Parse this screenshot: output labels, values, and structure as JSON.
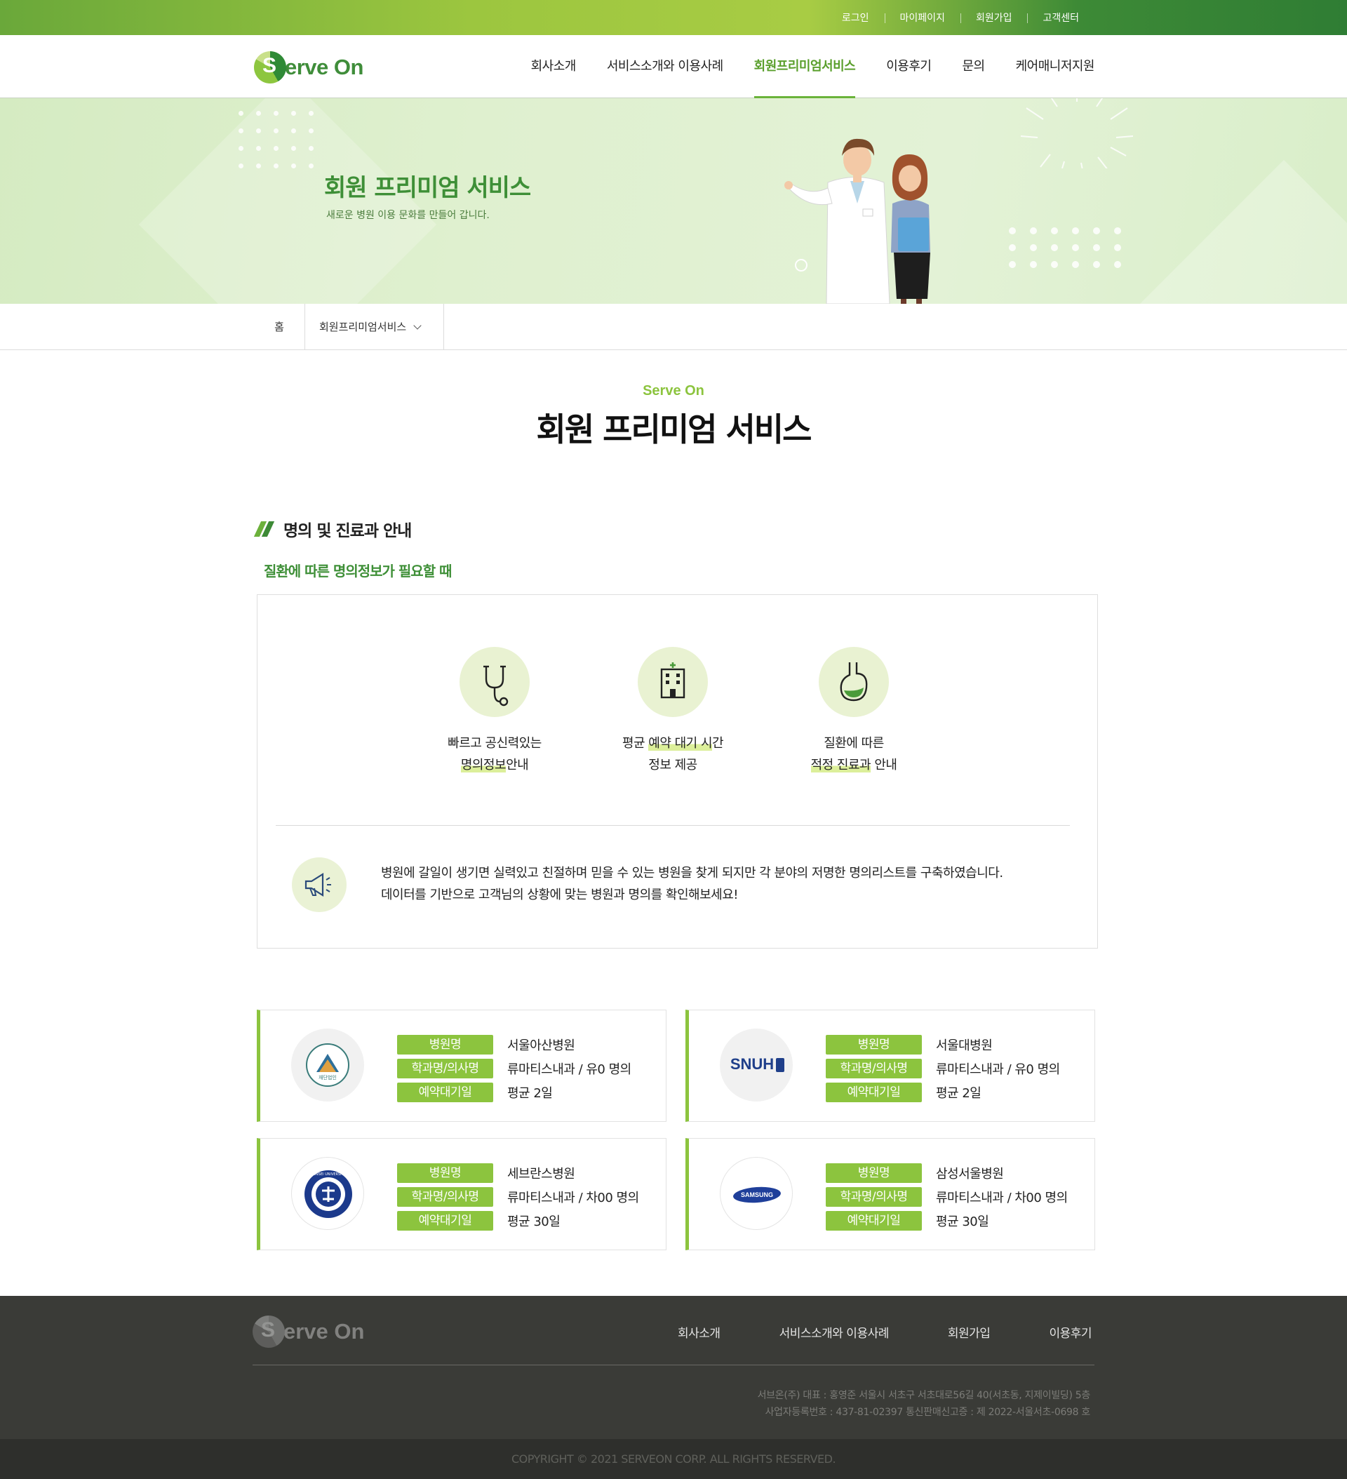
{
  "topbar": {
    "links": [
      "로그인",
      "마이페이지",
      "회원가입",
      "고객센터"
    ]
  },
  "header": {
    "logo_letter": "S",
    "logo_text": "erve On",
    "nav": [
      "회사소개",
      "서비스소개와 이용사례",
      "회원프리미엄서비스",
      "이용후기",
      "문의",
      "케어매니저지원"
    ],
    "active_nav": "회원프리미엄서비스"
  },
  "hero": {
    "title": "회원 프리미엄 서비스",
    "subtitle": "새로운 병원 이용 문화를 만들어 갑니다."
  },
  "breadcrumb": {
    "home": "홈",
    "current": "회원프리미엄서비스"
  },
  "main": {
    "brand": "Serve On",
    "title": "회원 프리미엄 서비스",
    "section_title": "명의 및 진료과 안내",
    "section_subtitle": "질환에 따른 명의정보가 필요할 때",
    "features": [
      {
        "icon": "stethoscope-icon",
        "line1": "빠르고 공신력있는",
        "line2_hl": "명의정보",
        "line2_rest": "안내"
      },
      {
        "icon": "hospital-icon",
        "line1_pre": "평균 ",
        "line1_hl": "예약 대기 시",
        "line1_post": "간",
        "line2": "정보 제공"
      },
      {
        "icon": "stomach-icon",
        "line1": "질환에 따른",
        "line2_hl": "적정 진료과",
        "line2_rest": " 안내"
      }
    ],
    "description": [
      "병원에 갈일이 생기면 실력있고 친절하며 믿을 수 있는 병원을 찾게 되지만 각 분야의 저명한 명의리스트를 구축하였습니다.",
      "데이터를 기반으로 고객님의 상황에 맞는 병원과 명의를 확인해보세요!"
    ]
  },
  "labels": {
    "hospital": "병원명",
    "department": "학과명/의사명",
    "wait": "예약대기일"
  },
  "hospitals": [
    {
      "logo": "asan-logo",
      "name": "서울아산병원",
      "dept": "류마티스내과 / 유0 명의",
      "wait": "평균 2일",
      "logo_text": "재단법인"
    },
    {
      "logo": "snuh-logo",
      "name": "서울대병원",
      "dept": "류마티스내과 / 유0 명의",
      "wait": "평균 2일",
      "logo_text": "SNUH"
    },
    {
      "logo": "yonsei-logo",
      "name": "세브란스병원",
      "dept": "류마티스내과 / 차00 명의",
      "wait": "평균 30일",
      "logo_text": "YONSEI UNIVERSITY"
    },
    {
      "logo": "samsung-logo",
      "name": "삼성서울병원",
      "dept": "류마티스내과 / 차00 명의",
      "wait": "평균 30일",
      "logo_text": "SAMSUNG"
    }
  ],
  "footer": {
    "logo_letter": "S",
    "logo_text": "erve On",
    "nav": [
      "회사소개",
      "서비스소개와 이용사례",
      "회원가입",
      "이용후기"
    ],
    "address_1": "서브온(주) 대표 : 홍영준 서울시 서초구 서초대로56길 40(서초동, 지제이빌딩) 5층",
    "address_2": "사업자등록번호 : 437-81-02397  통신판매신고증 : 제 2022-서울서초-0698 호",
    "copyright": "COPYRIGHT © 2021 SERVEON CORP. ALL RIGHTS RESERVED."
  },
  "colors": {
    "brand_green": "#3e8f37",
    "accent_lime": "#8cc43e",
    "footer_bg": "#3a3b37"
  }
}
